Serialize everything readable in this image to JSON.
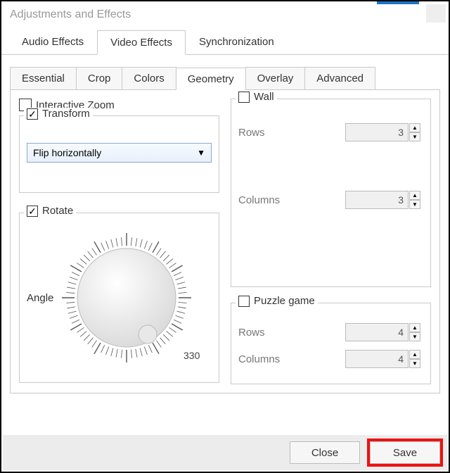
{
  "window": {
    "title": "Adjustments and Effects"
  },
  "mainTabs": {
    "audio": "Audio Effects",
    "video": "Video Effects",
    "sync": "Synchronization"
  },
  "subTabs": {
    "essential": "Essential",
    "crop": "Crop",
    "colors": "Colors",
    "geometry": "Geometry",
    "overlay": "Overlay",
    "advanced": "Advanced"
  },
  "geometry": {
    "interactiveZoom": {
      "label": "Interactive Zoom",
      "checked": false
    },
    "transform": {
      "label": "Transform",
      "checked": true,
      "value": "Flip horizontally"
    },
    "rotate": {
      "label": "Rotate",
      "checked": true,
      "angleLabel": "Angle",
      "tickValue": "330"
    },
    "wall": {
      "label": "Wall",
      "checked": false,
      "rowsLabel": "Rows",
      "rows": "3",
      "colsLabel": "Columns",
      "cols": "3"
    },
    "puzzle": {
      "label": "Puzzle game",
      "checked": false,
      "rowsLabel": "Rows",
      "rows": "4",
      "colsLabel": "Columns",
      "cols": "4"
    }
  },
  "buttons": {
    "close": "Close",
    "save": "Save"
  }
}
